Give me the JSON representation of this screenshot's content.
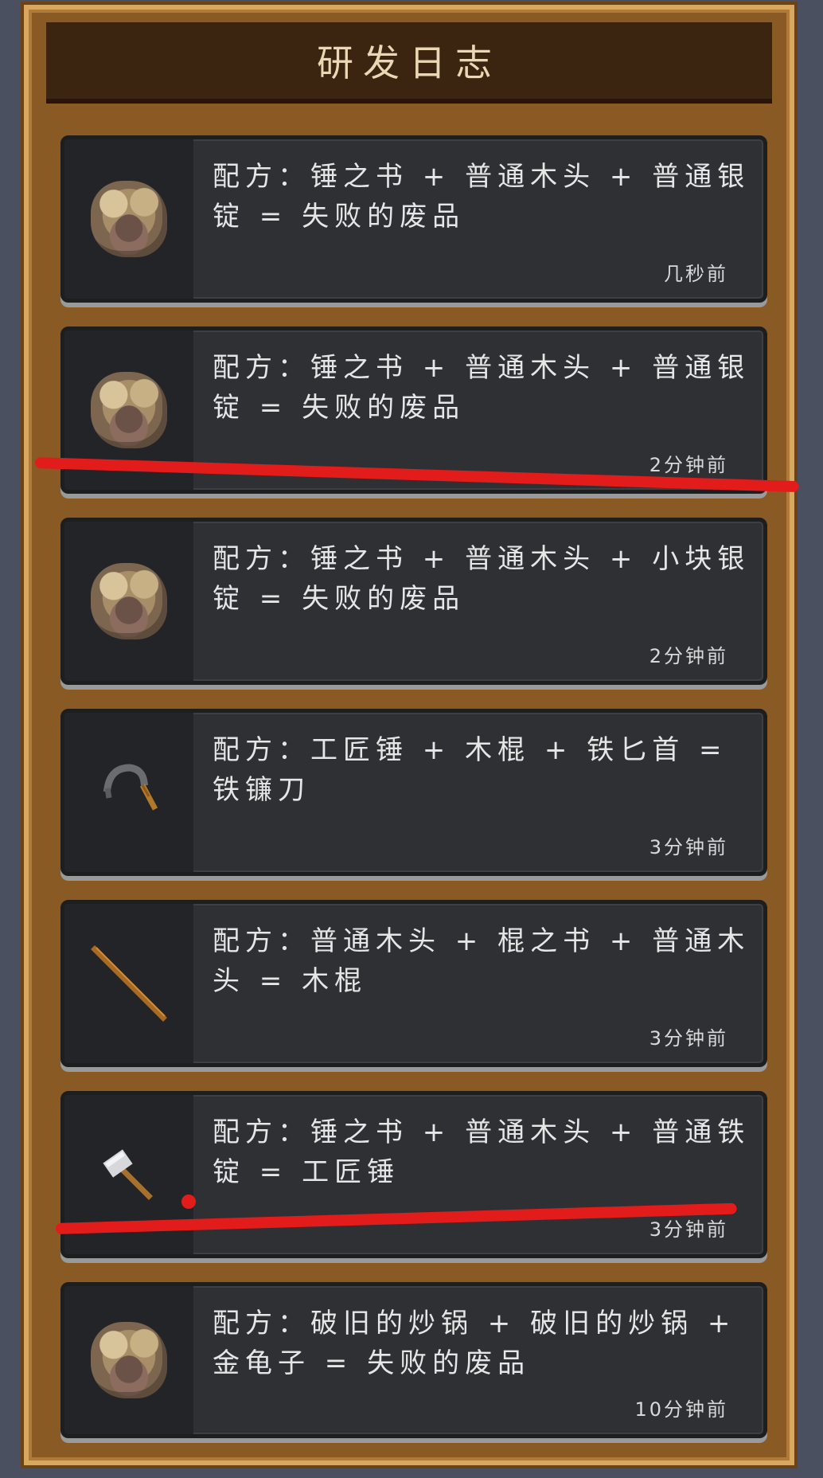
{
  "panel": {
    "title": "研发日志"
  },
  "entries": [
    {
      "icon": "failed-scrap-icon",
      "recipe": "配方：锤之书 + 普通木头 + 普通银锭 = 失败的废品",
      "time": "几秒前"
    },
    {
      "icon": "failed-scrap-icon",
      "recipe": "配方：锤之书 + 普通木头 + 普通银锭 = 失败的废品",
      "time": "2分钟前"
    },
    {
      "icon": "failed-scrap-icon",
      "recipe": "配方：锤之书 + 普通木头 + 小块银锭 = 失败的废品",
      "time": "2分钟前"
    },
    {
      "icon": "iron-sickle-icon",
      "recipe": "配方：工匠锤 + 木棍 + 铁匕首 = 铁镰刀",
      "time": "3分钟前"
    },
    {
      "icon": "wooden-stick-icon",
      "recipe": "配方：普通木头 + 棍之书 + 普通木头 = 木棍",
      "time": "3分钟前"
    },
    {
      "icon": "craftsman-hammer-icon",
      "recipe": "配方：锤之书 + 普通木头 + 普通铁锭 = 工匠锤",
      "time": "3分钟前"
    },
    {
      "icon": "failed-scrap-icon",
      "recipe": "配方：破旧的炒锅 + 破旧的炒锅 + 金龟子 = 失败的废品",
      "time": "10分钟前"
    }
  ],
  "colors": {
    "annotation": "#e21b1b",
    "frame": "#d8a861",
    "card": "#2f3033"
  }
}
